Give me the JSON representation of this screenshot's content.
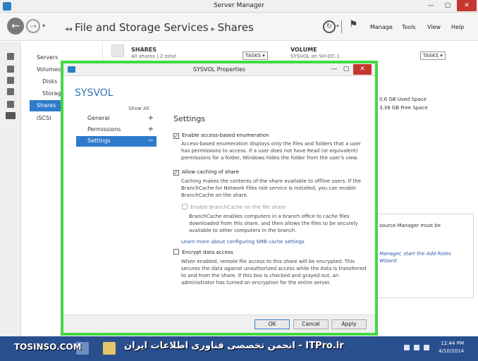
{
  "window": {
    "title": "Server Manager",
    "min": "—",
    "max": "▢",
    "close": "✕"
  },
  "nav": {
    "back": "←",
    "forward": "→",
    "dropdown": "▾",
    "breadcrumb_prefix": "◂◂",
    "breadcrumb_1": "File and Storage Services",
    "breadcrumb_sep": "▸",
    "breadcrumb_2": "Shares",
    "refresh": "↻",
    "menus": [
      "Manage",
      "Tools",
      "View",
      "Help"
    ]
  },
  "subnav": {
    "items": [
      "Servers",
      "Volumes",
      "Disks",
      "Storage",
      "Shares",
      "iSCSI"
    ]
  },
  "shares_tile": {
    "title": "SHARES",
    "subtitle": "All shares | 2 total",
    "tasks": "TASKS  ▾"
  },
  "volume_tile": {
    "title": "VOLUME",
    "subtitle": "SYSVOL on SH-DC-1",
    "tasks": "TASKS  ▾",
    "used": "0.6 GB Used Space",
    "free": "3.38 GB Free Space",
    "fsrm_note": "source Manager must be",
    "wizard_line1": "Manager, start the Add Roles",
    "wizard_line2": "Wizard."
  },
  "dialog": {
    "title": "SYSVOL Properties",
    "heading": "SYSVOL",
    "show_all": "Show All",
    "nav": [
      {
        "label": "General",
        "sign": "+"
      },
      {
        "label": "Permissions",
        "sign": "+"
      },
      {
        "label": "Settings",
        "sign": "−"
      }
    ],
    "section_title": "Settings",
    "abe_label": "Enable access-based enumeration",
    "abe_checked": true,
    "abe_desc_1": "Access-based enumeration displays only the files and folders that a user",
    "abe_desc_2": "has permissions to access. If a user does not have Read (or equivalent)",
    "abe_desc_3": "permissions for a folder, Windows hides the folder from the user's view.",
    "cache_label": "Allow caching of share",
    "cache_checked": true,
    "cache_desc_1": "Caching makes the contents of the share available to offline users. If the",
    "cache_desc_2": "BranchCache for Network Files role service is installed, you can enable",
    "cache_desc_3": "BranchCache on the share.",
    "branch_label": "Enable BranchCache on the file share",
    "branch_checked": false,
    "branch_desc_1": "BranchCache enables computers in a branch office to cache files",
    "branch_desc_2": "downloaded from this share, and then allows the files to be securely",
    "branch_desc_3": "available to other computers in the branch.",
    "smb_link": "Learn more about configuring SMB cache settings",
    "encrypt_label": "Encrypt data access",
    "encrypt_checked": false,
    "encrypt_desc_1": "When enabled, remote file access to this share will be encrypted. This",
    "encrypt_desc_2": "secures the data against unauthorized access while the data is transferred",
    "encrypt_desc_3": "to and from the share. If this box is checked and grayed out, an",
    "encrypt_desc_4": "administrator has turned on encryption for the entire server.",
    "ok": "OK",
    "cancel": "Cancel",
    "apply": "Apply"
  },
  "taskbar": {
    "time": "12:44 PM",
    "date": "4/10/2014",
    "watermark_left": "TOSINSO.COM",
    "watermark_right": "انجمن تخصصی فناوری اطلاعات ایران - ITPro.ir"
  }
}
